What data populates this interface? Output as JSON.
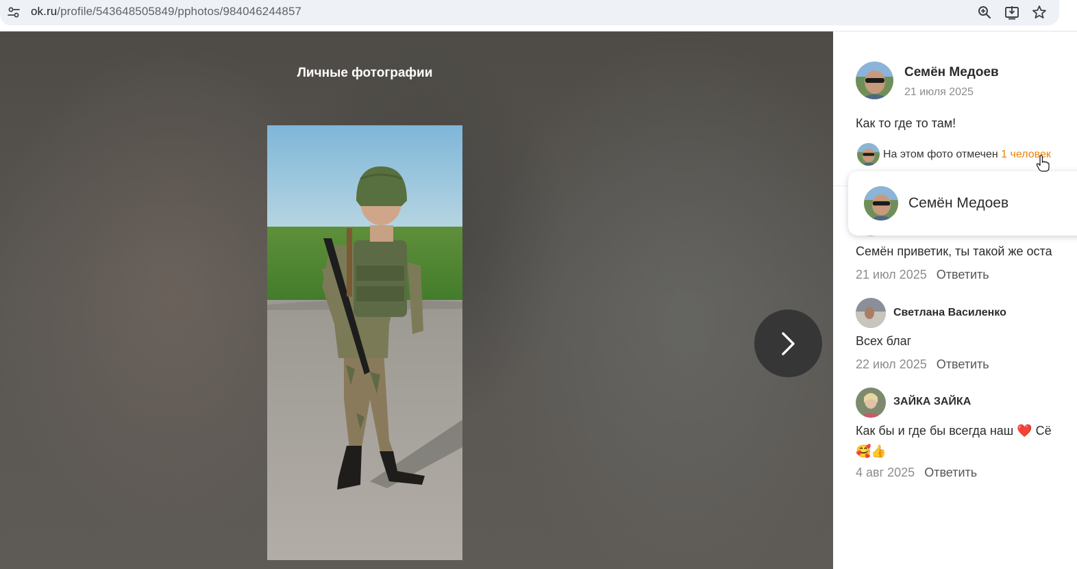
{
  "browser": {
    "url_host": "ok.ru",
    "url_path": "/profile/543648505849/pphotos/984046244857"
  },
  "viewer": {
    "album_title": "Личные фотографии"
  },
  "post": {
    "author_name": "Семён Медоев",
    "date": "21 июля 2025",
    "text": "Как то где то там!",
    "tag_prefix": "На этом фото отмечен",
    "tag_link": "1 человек"
  },
  "tag_popup": {
    "name": "Семён Медоев"
  },
  "comments": [
    {
      "author": "",
      "text": "Семён приветик, ты такой же оста",
      "date": "21 июл 2025",
      "reply": "Ответить"
    },
    {
      "author": "Светлана Василенко",
      "text": "Всех благ",
      "date": "22 июл 2025",
      "reply": "Ответить"
    },
    {
      "author": "ЗАЙКА ЗАЙКА",
      "text": "Как бы и где бы всегда наш ❤️ Сё",
      "text2": "🥰👍",
      "date": "4 авг 2025",
      "reply": "Ответить"
    }
  ],
  "colors": {
    "accent": "#ee8208",
    "viewer_bg": "#54514c",
    "next_button": "#363636"
  },
  "icons": [
    "site-settings-icon",
    "zoom-icon",
    "install-icon",
    "bookmark-star-icon",
    "chevron-right-icon",
    "hand-cursor-icon"
  ]
}
